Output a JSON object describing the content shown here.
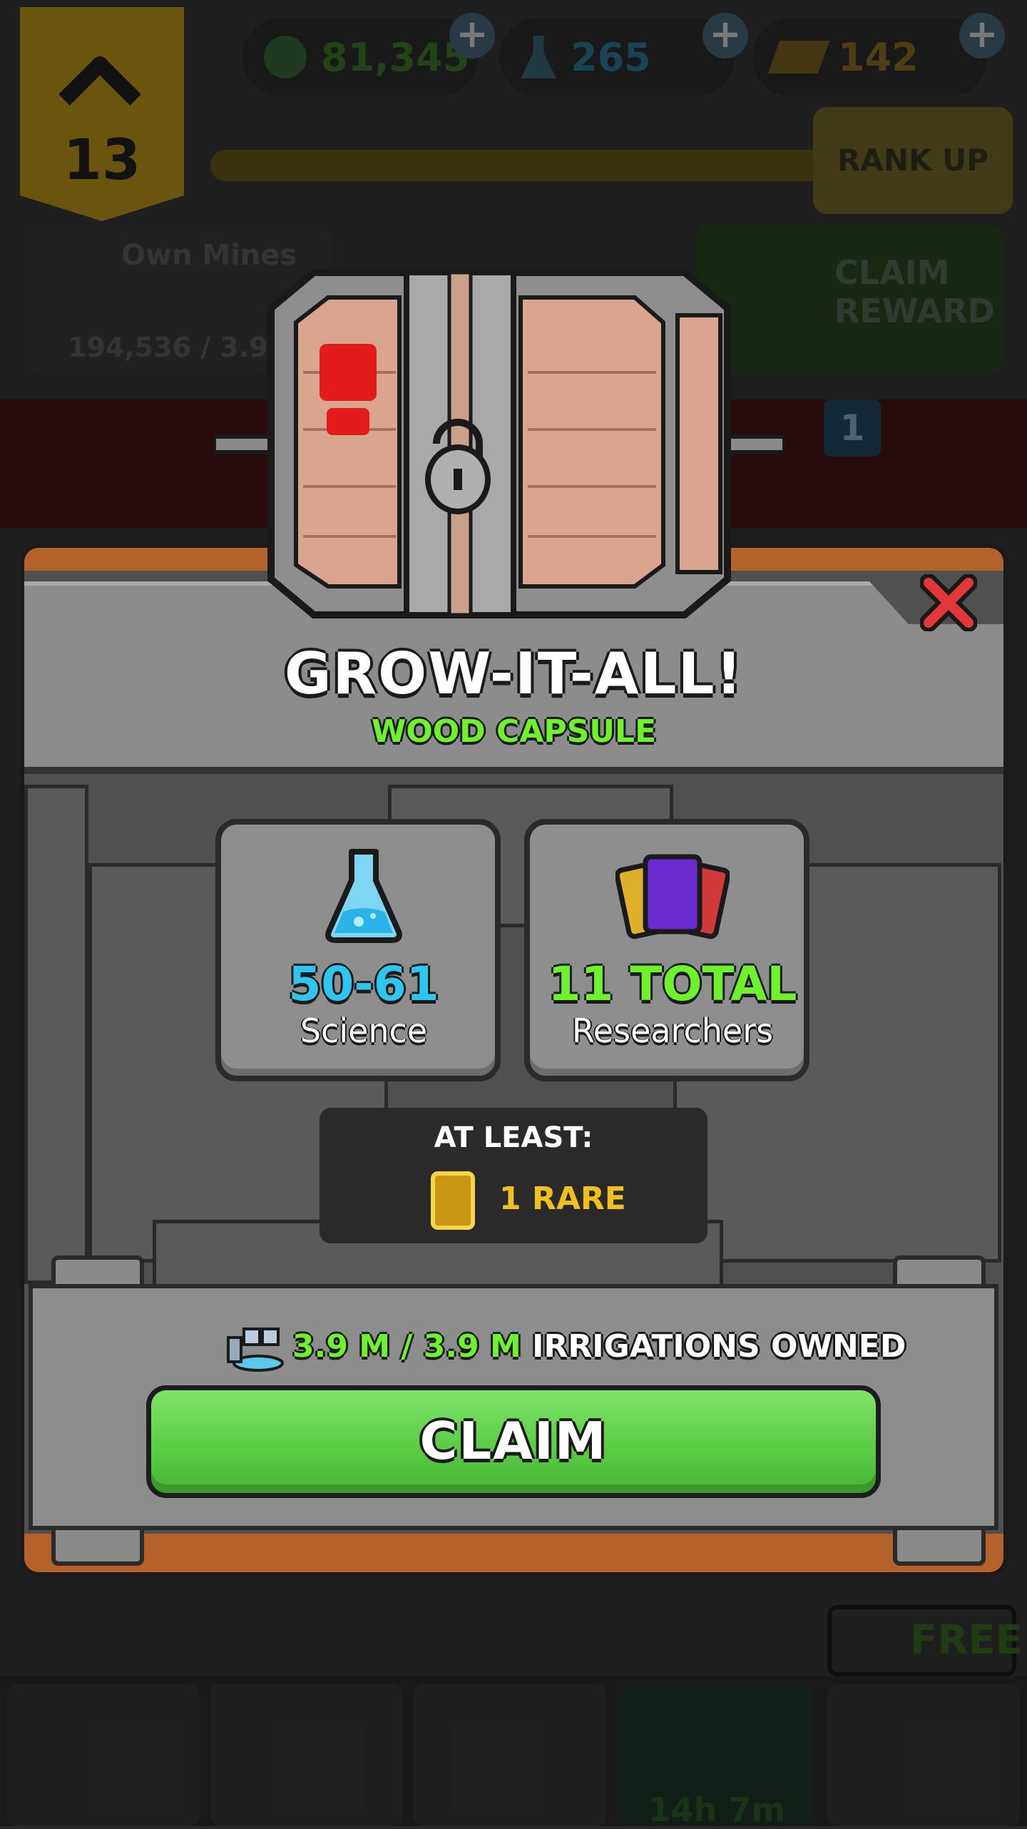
{
  "top_bar": {
    "rank_level": "13",
    "cash": "81,345",
    "science": "265",
    "gold": "142",
    "rank_up_label": "RANK UP"
  },
  "mission_cards": {
    "own_mines_label": "Own Mines",
    "own_mines_progress": "194,536 / 3.9",
    "claim_reward_label_line1": "CLAIM",
    "claim_reward_label_line2": "REWARD",
    "badge_count": "1"
  },
  "modal": {
    "title": "GROW-IT-ALL!",
    "subtitle": "WOOD CAPSULE",
    "science_value": "50-61",
    "science_label": "Science",
    "researchers_value": "11 TOTAL",
    "researchers_label": "Researchers",
    "at_least_label": "AT LEAST:",
    "rare_label": "1 RARE",
    "progress_current": "3.9 M / 3.9 M",
    "progress_suffix": "IRRIGATIONS OWNED",
    "claim_label": "CLAIM"
  },
  "bottom_bar": {
    "free_label": "FREE",
    "timer": "14h 7m"
  },
  "colors": {
    "green_accent": "#6ef22b",
    "blue_accent": "#2cc6f0",
    "rare_gold": "#f2c01e",
    "wood": "#b5622a"
  },
  "icons": [
    "flask-icon",
    "researcher-cards-icon",
    "rare-card-icon",
    "irrigation-icon",
    "close-icon",
    "wood-capsule-icon"
  ]
}
